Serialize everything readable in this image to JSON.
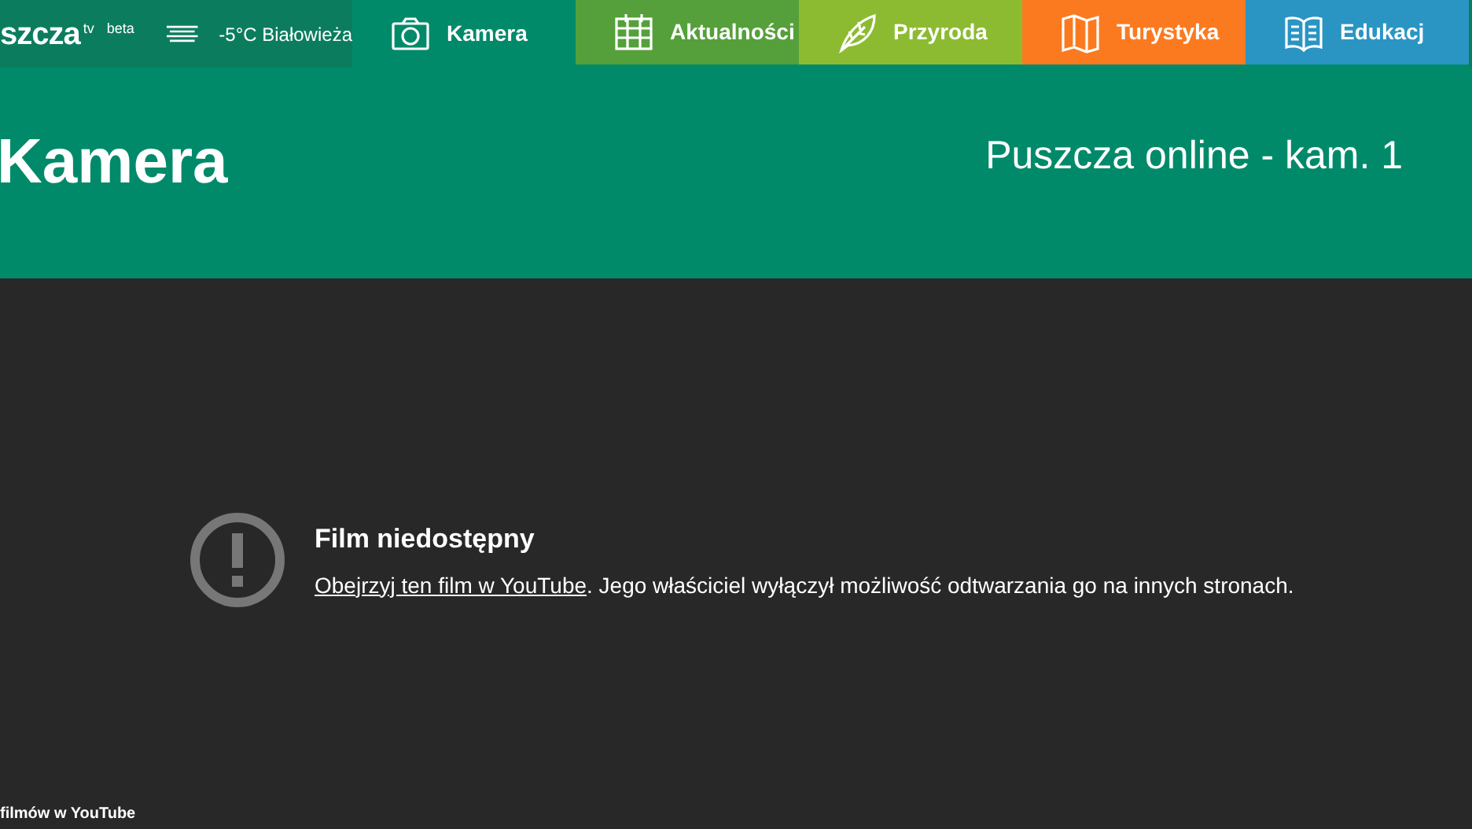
{
  "logo": {
    "text": "szcza",
    "superscript": "tv",
    "badge": "beta"
  },
  "weather": {
    "temperature": "-5°C",
    "place": "Białowieża"
  },
  "tabs": [
    {
      "label": "Kamera",
      "kind": "camera",
      "color": "#008a6a",
      "selected": true
    },
    {
      "label": "Aktualności",
      "kind": "calendar",
      "color": "#55a03a",
      "selected": false
    },
    {
      "label": "Przyroda",
      "kind": "leaf",
      "color": "#8cbb31",
      "selected": false
    },
    {
      "label": "Turystyka",
      "kind": "map",
      "color": "#fb7a20",
      "selected": false
    },
    {
      "label": "Edukacj",
      "kind": "book",
      "color": "#2a95c3",
      "selected": false
    }
  ],
  "header": {
    "title": "Kamera",
    "subtitle": "Puszcza online - kam. 1"
  },
  "player": {
    "error_title": "Film niedostępny",
    "link": "Obejrzyj ten film w YouTube",
    "message": ". Jego właściciel wyłączył możliwość odtwarzania go na innych stronach.",
    "footer": "filmów w YouTube"
  }
}
